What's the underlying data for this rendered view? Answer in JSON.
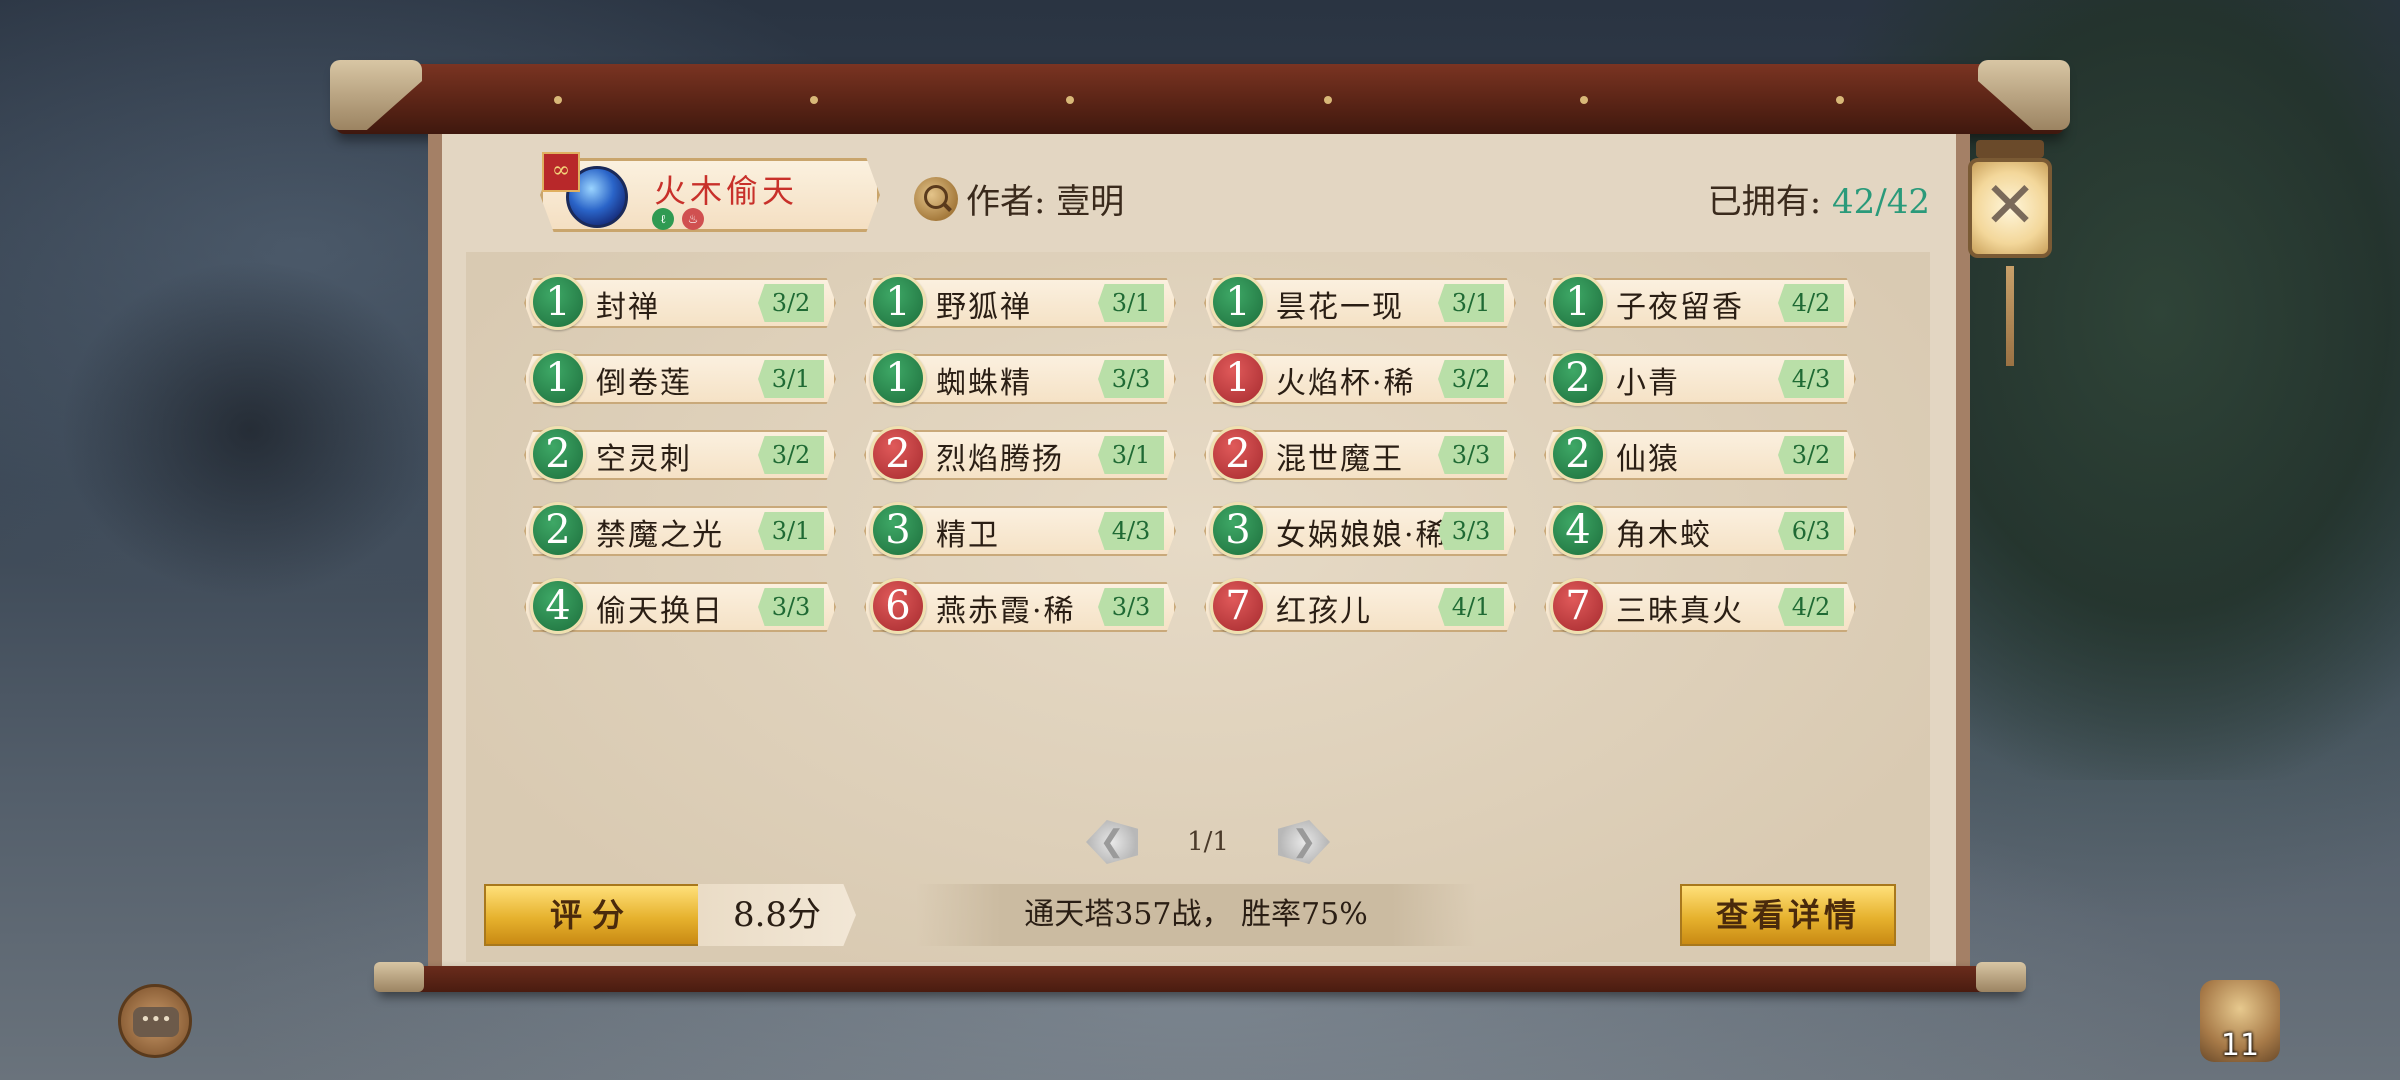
{
  "deck": {
    "name": "火木偷天",
    "flag_icon": "link-icon",
    "tags": [
      {
        "icon": "wood-element-icon",
        "color": "#2f9a52"
      },
      {
        "icon": "fire-element-icon",
        "color": "#d05050"
      }
    ]
  },
  "author": {
    "label": "作者: 壹明"
  },
  "owned": {
    "label": "已拥有: ",
    "value": "42/42"
  },
  "cards": [
    {
      "cost": "1",
      "color": "green",
      "name": "封禅",
      "stat": "3/2"
    },
    {
      "cost": "1",
      "color": "green",
      "name": "野狐禅",
      "stat": "3/1"
    },
    {
      "cost": "1",
      "color": "green",
      "name": "昙花一现",
      "stat": "3/1"
    },
    {
      "cost": "1",
      "color": "green",
      "name": "子夜留香",
      "stat": "4/2"
    },
    {
      "cost": "1",
      "color": "green",
      "name": "倒卷莲",
      "stat": "3/1"
    },
    {
      "cost": "1",
      "color": "green",
      "name": "蜘蛛精",
      "stat": "3/3"
    },
    {
      "cost": "1",
      "color": "red",
      "name": "火焰杯·稀",
      "stat": "3/2"
    },
    {
      "cost": "2",
      "color": "green",
      "name": "小青",
      "stat": "4/3"
    },
    {
      "cost": "2",
      "color": "green",
      "name": "空灵刺",
      "stat": "3/2"
    },
    {
      "cost": "2",
      "color": "red",
      "name": "烈焰腾扬",
      "stat": "3/1"
    },
    {
      "cost": "2",
      "color": "red",
      "name": "混世魔王",
      "stat": "3/3"
    },
    {
      "cost": "2",
      "color": "green",
      "name": "仙猿",
      "stat": "3/2"
    },
    {
      "cost": "2",
      "color": "green",
      "name": "禁魔之光",
      "stat": "3/1"
    },
    {
      "cost": "3",
      "color": "green",
      "name": "精卫",
      "stat": "4/3"
    },
    {
      "cost": "3",
      "color": "green",
      "name": "女娲娘娘·稀",
      "stat": "3/3"
    },
    {
      "cost": "4",
      "color": "green",
      "name": "角木蛟",
      "stat": "6/3"
    },
    {
      "cost": "4",
      "color": "green",
      "name": "偷天换日",
      "stat": "3/3"
    },
    {
      "cost": "6",
      "color": "red",
      "name": "燕赤霞·稀",
      "stat": "3/3"
    },
    {
      "cost": "7",
      "color": "red",
      "name": "红孩儿",
      "stat": "4/1"
    },
    {
      "cost": "7",
      "color": "red",
      "name": "三昧真火",
      "stat": "4/2"
    }
  ],
  "pager": {
    "text": "1/1",
    "prev_icon": "chevron-left-icon",
    "next_icon": "chevron-right-icon"
  },
  "footer": {
    "rate_label": "评分",
    "score": "8.8分",
    "record": "通天塔357战， 胜率75%",
    "detail_label": "查看详情"
  },
  "close": {
    "icon": "close-icon",
    "glyph": "✕"
  },
  "hud": {
    "chat_icon": "chat-icon",
    "chat_glyph": "•••",
    "bag_icon": "bag-icon",
    "bag_count": "11"
  }
}
